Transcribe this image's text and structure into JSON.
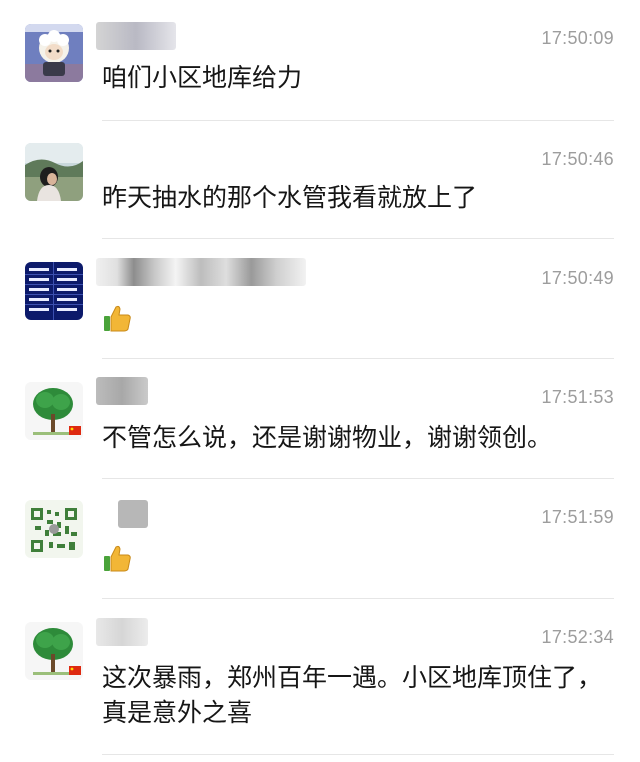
{
  "messages": [
    {
      "avatar": "pleasant-goat-avatar",
      "time": "17:50:09",
      "text": "咱们小区地库给力"
    },
    {
      "avatar": "woman-landscape-avatar",
      "time": "17:50:46",
      "text": "昨天抽水的那个水管我看就放上了"
    },
    {
      "avatar": "text-grid-avatar",
      "time": "17:50:49",
      "emoji": "thumbs-up-icon"
    },
    {
      "avatar": "tree-flag-avatar",
      "time": "17:51:53",
      "text": "不管怎么说，还是谢谢物业，谢谢领创。"
    },
    {
      "avatar": "qr-code-avatar",
      "time": "17:51:59",
      "emoji": "thumbs-up-icon"
    },
    {
      "avatar": "tree-flag-avatar",
      "time": "17:52:34",
      "text": "这次暴雨，郑州百年一遇。小区地库顶住了，真是意外之喜"
    }
  ],
  "colors": {
    "time": "#9d9d9d",
    "divider": "#e6e6e6",
    "thumb": "#f2b636"
  }
}
